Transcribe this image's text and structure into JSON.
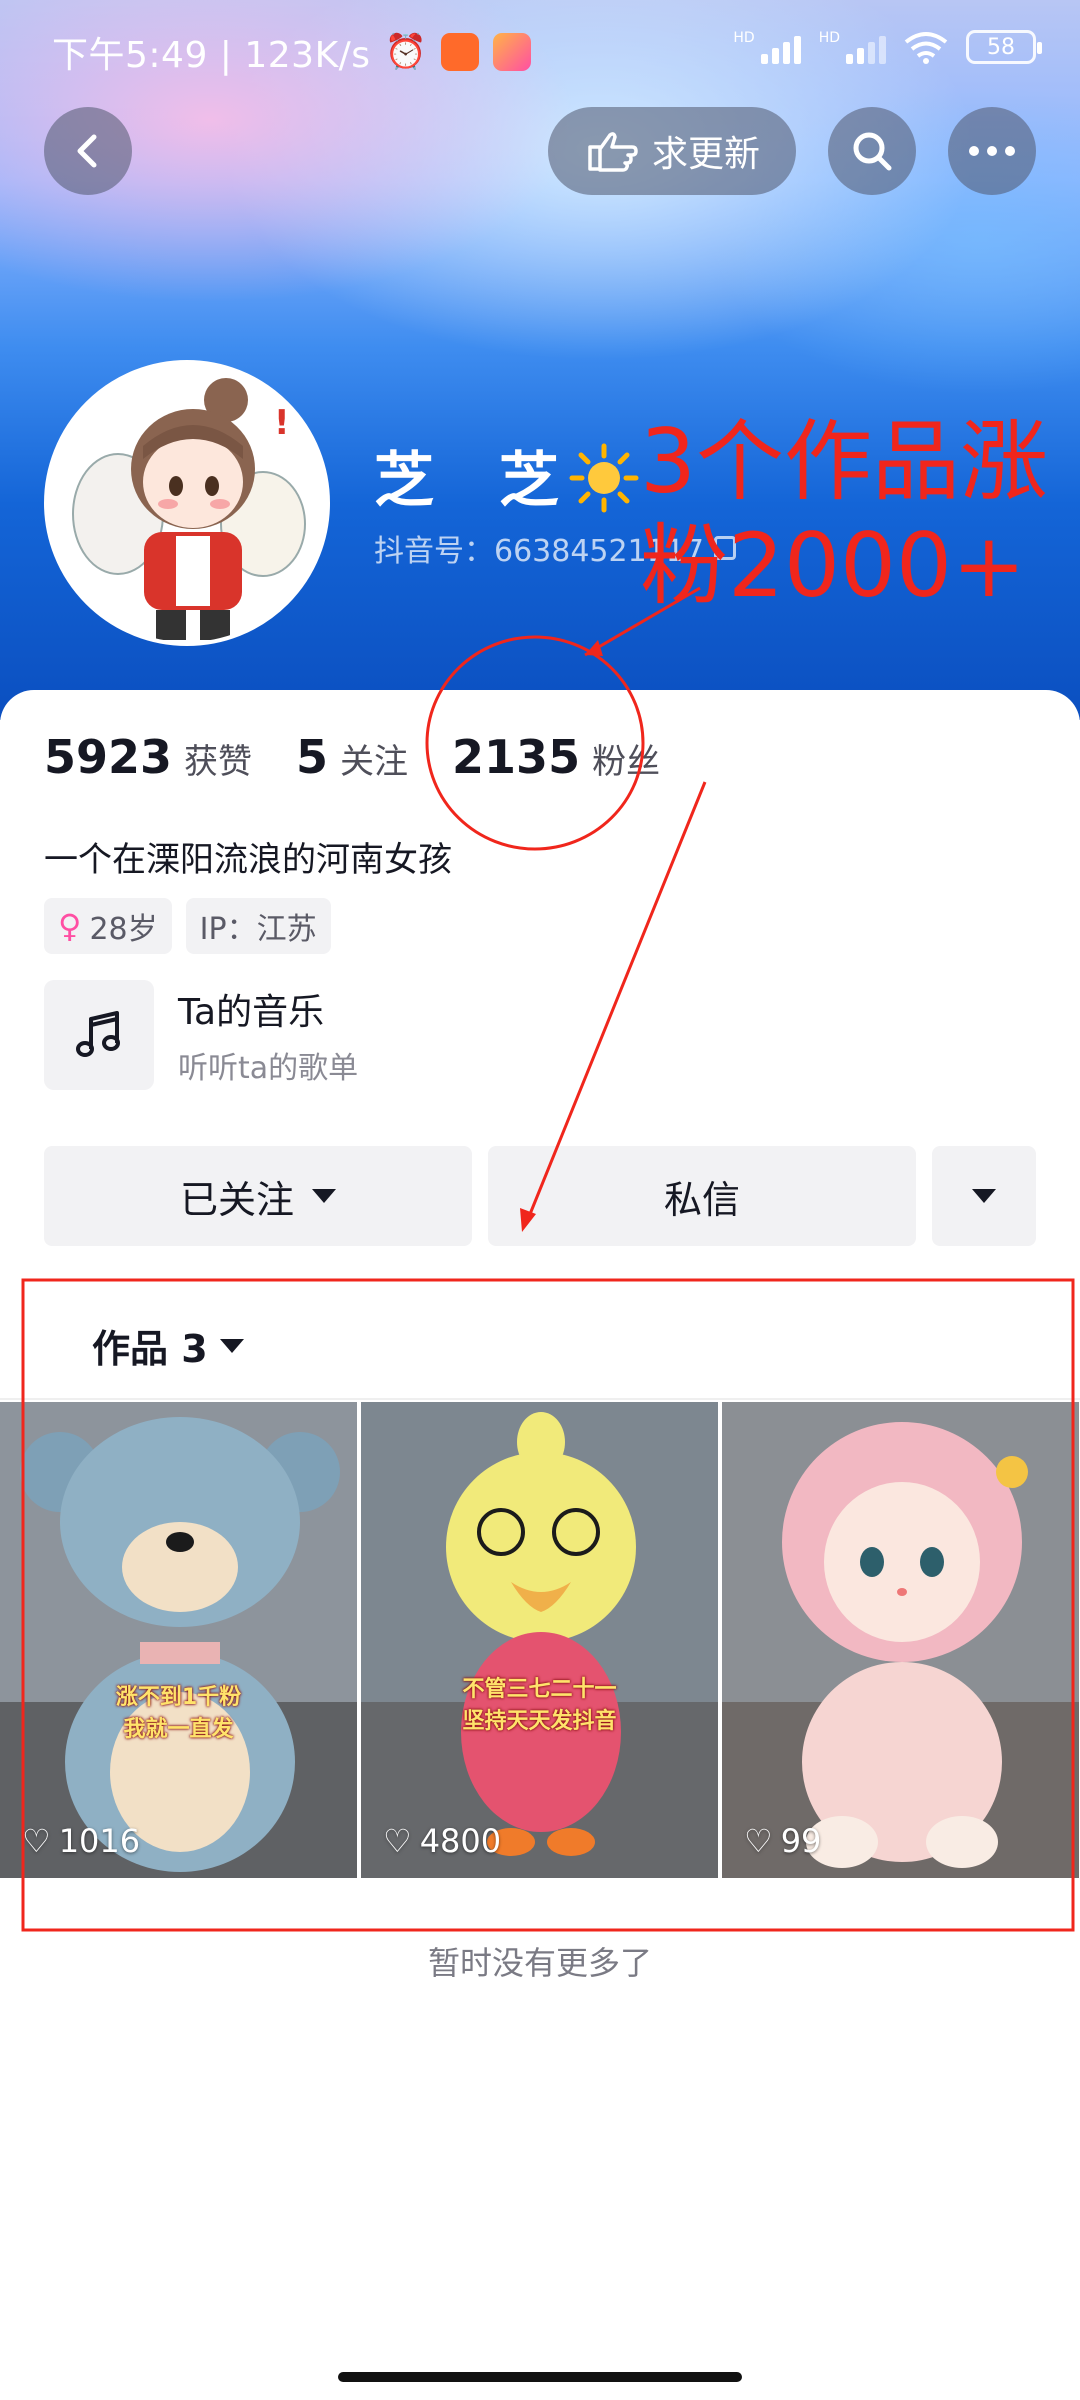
{
  "status_bar": {
    "time_speed": "下午5:49 | 123K/s",
    "signal_1_label": "HD",
    "signal_2_label": "HD",
    "battery": "58"
  },
  "top_bar": {
    "update_label": "求更新",
    "icons": [
      "back-icon",
      "hand-point-icon",
      "search-icon",
      "more-icon"
    ]
  },
  "profile": {
    "nickname": "芝 芝",
    "douyin_id": "抖音号：66384521117"
  },
  "annotation": {
    "text": "3个作品涨粉2000+",
    "color": "#f0261c"
  },
  "stats": [
    {
      "value": "5923",
      "label": "获赞"
    },
    {
      "value": "5",
      "label": "关注"
    },
    {
      "value": "2135",
      "label": "粉丝"
    }
  ],
  "bio": "一个在溧阳流浪的河南女孩",
  "tags": {
    "age": "28岁",
    "ip": "IP：江苏"
  },
  "music": {
    "title": "Ta的音乐",
    "subtitle": "听听ta的歌单"
  },
  "actions": {
    "followed": "已关注",
    "message": "私信"
  },
  "works": {
    "label": "作品 3",
    "items": [
      {
        "likes": "1016",
        "caption_1": "涨不到1千粉",
        "caption_2": "我就一直发"
      },
      {
        "likes": "4800",
        "caption_1": "不管三七二十一",
        "caption_2": "坚持天天发抖音"
      },
      {
        "likes": "99",
        "caption_1": "",
        "caption_2": ""
      }
    ]
  },
  "footer": {
    "no_more": "暂时没有更多了"
  }
}
